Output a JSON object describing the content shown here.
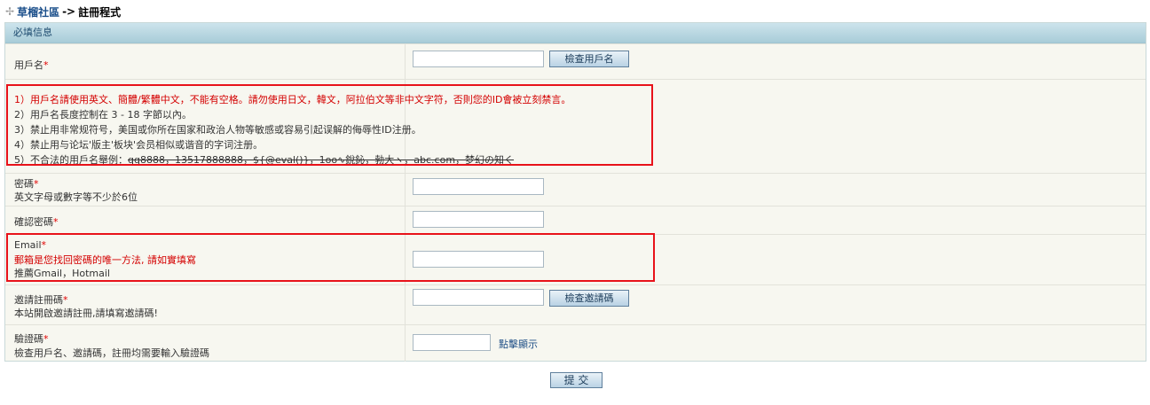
{
  "breadcrumb": {
    "site": "草榴社區",
    "separator": "->",
    "page": "註冊程式"
  },
  "section": {
    "title": "必填信息"
  },
  "username": {
    "label": "用戶名",
    "required_mark": "*",
    "check_button": "檢查用戶名",
    "value": ""
  },
  "rules": [
    "1）用戶名請使用英文、簡體/繁體中文，不能有空格。請勿使用日文，韓文，阿拉伯文等非中文字符，否則您的ID會被立刻禁言。",
    "2）用戶名長度控制在 3 - 18 字節以內。",
    "3）禁止用非常规符号，美国或你所在国家和政治人物等敏感或容易引起误解的侮辱性ID注册。",
    "4）禁止用与论坛'版主'板块'会员相似或谐音的字词注册。",
    "5）不合法的用戶名舉例："
  ],
  "rules_example": "qq8888，13517888888，${@eval()}，1oo∿銳鈊，勃大ヽ，abc.com，梦幻の知く",
  "password": {
    "label": "密碼",
    "required_mark": "*",
    "hint": "英文字母或數字等不少於6位"
  },
  "confirm_password": {
    "label": "確認密碼",
    "required_mark": "*"
  },
  "email": {
    "label": "Email",
    "required_mark": "*",
    "warning": "郵箱是您找回密碼的唯一方法, 請如實填寫",
    "hint": "推薦Gmail，Hotmail"
  },
  "invite_code": {
    "label": "邀請註冊碼",
    "required_mark": "*",
    "hint": "本站開啟邀請註冊,請填寫邀請碼!",
    "check_button": "檢查邀請碼"
  },
  "captcha": {
    "label": "驗證碼",
    "required_mark": "*",
    "hint": "檢查用戶名、邀請碼，註冊均需要輸入驗證碼",
    "show_link": "點擊顯示"
  },
  "submit_button": "提 交",
  "colors": {
    "highlight_border": "#e8121a",
    "required": "#e00000",
    "header_bg": "#a8ccd8"
  }
}
